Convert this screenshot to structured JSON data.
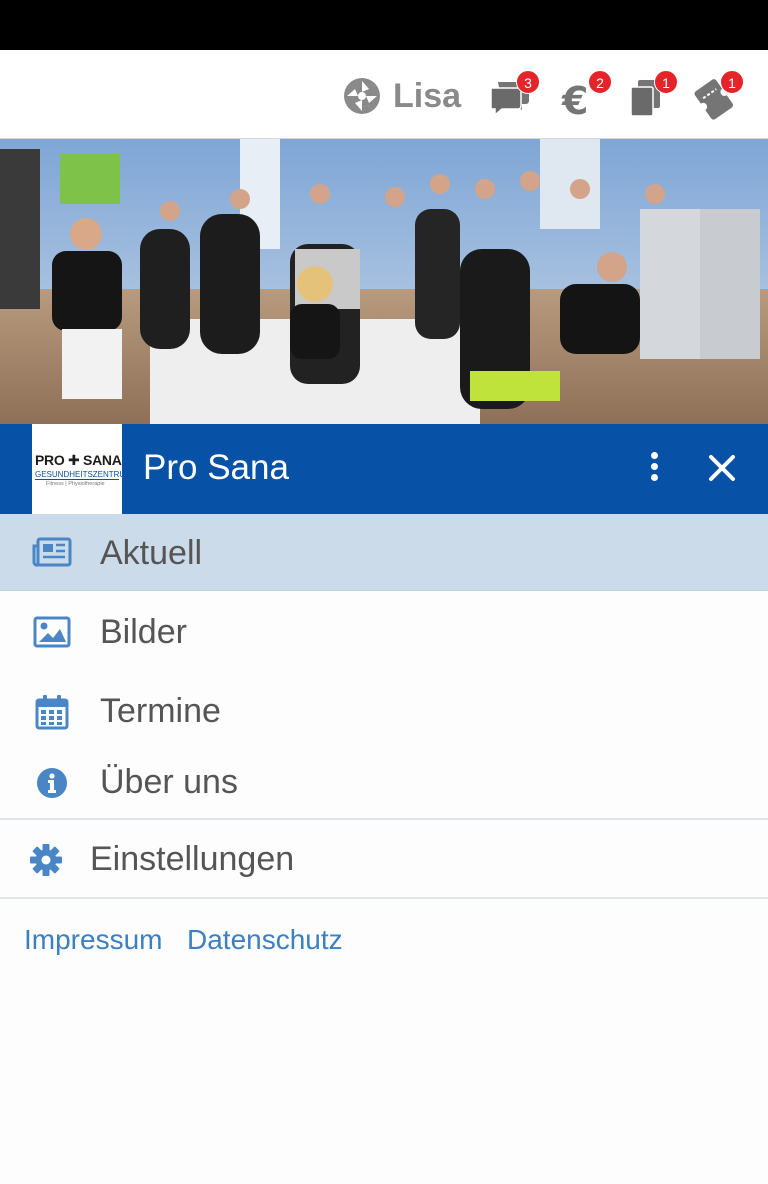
{
  "topbar": {
    "user_name": "Lisa",
    "messages_badge": "3",
    "payments_badge": "2",
    "documents_badge": "1",
    "tickets_badge": "1"
  },
  "brand": {
    "title": "Pro Sana",
    "logo_line1": "PRO ✚ SANA",
    "logo_line2": "GESUNDHEITSZENTRUM",
    "logo_line3": "Fitness | Physiotherapie"
  },
  "menu": {
    "items": [
      {
        "label": "Aktuell",
        "icon": "newspaper-icon"
      },
      {
        "label": "Bilder",
        "icon": "image-icon"
      },
      {
        "label": "Termine",
        "icon": "calendar-icon"
      },
      {
        "label": "Über uns",
        "icon": "info-icon"
      }
    ],
    "settings": {
      "label": "Einstellungen",
      "icon": "gear-icon"
    }
  },
  "footer": {
    "impressum": "Impressum",
    "datenschutz": "Datenschutz"
  },
  "colors": {
    "brand_blue": "#0751a6",
    "active_row": "#ccdbea",
    "badge_red": "#e5242a",
    "link_blue": "#3b7fc4"
  }
}
